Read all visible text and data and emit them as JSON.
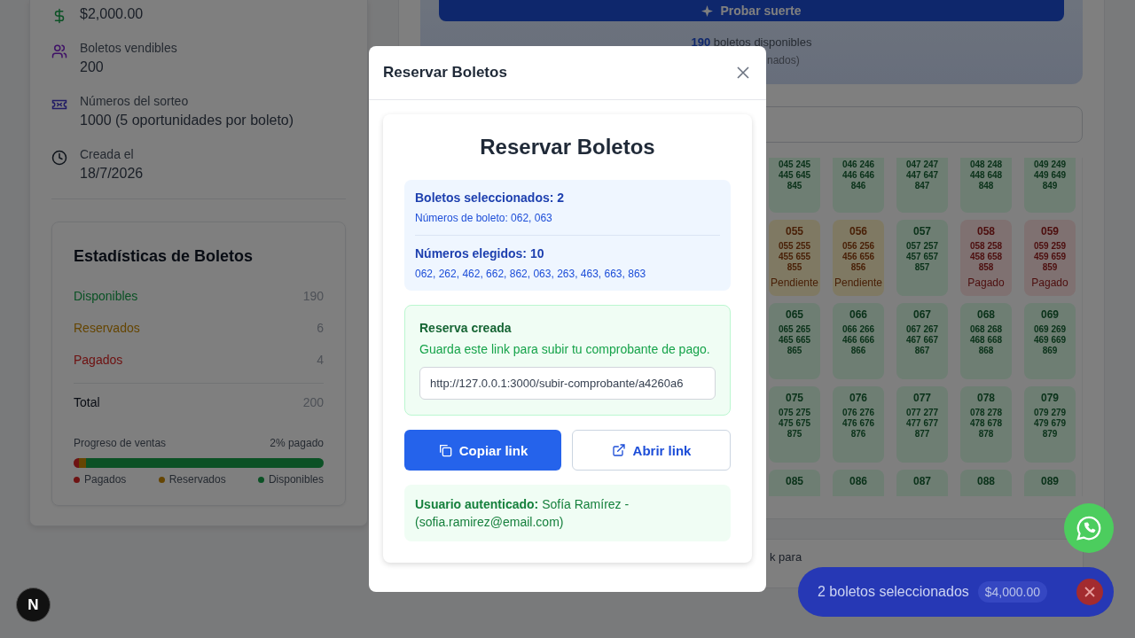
{
  "details": [
    {
      "kind": "price",
      "value": "$2,000.00"
    },
    {
      "kind": "tickets",
      "label": "Boletos vendibles",
      "value": "200"
    },
    {
      "kind": "numbers",
      "label": "Números del sorteo",
      "value": "1000 (5 oportunidades por boleto)"
    },
    {
      "kind": "date",
      "label": "Creada el",
      "value": "18/7/2026"
    }
  ],
  "stats": {
    "title": "Estadísticas de Boletos",
    "rows": [
      {
        "label": "Disponibles",
        "value": "190",
        "kind": "available"
      },
      {
        "label": "Reservados",
        "value": "6",
        "kind": "reserved"
      },
      {
        "label": "Pagados",
        "value": "4",
        "kind": "paid"
      }
    ],
    "total": {
      "label": "Total",
      "value": "200"
    },
    "progress": {
      "label": "Progreso de ventas",
      "reading": "2% pagado",
      "segments": [
        {
          "name": "Pagados",
          "level": 0.02,
          "kind": "paid"
        },
        {
          "name": "Reservados",
          "level": 0.03,
          "kind": "reserved"
        },
        {
          "name": "Disponibles",
          "level": 0.95,
          "kind": "available"
        }
      ]
    }
  },
  "lucky": {
    "button": "Probar suerte",
    "available": "**190** boletos disponibles",
    "selected_note": "nados)"
  },
  "ticket_rows": [
    {
      "tickets": [
        {
          "numbers": [
            "045 245",
            "445 645",
            "845"
          ],
          "kind": "available"
        },
        {
          "numbers": [
            "046 246",
            "446 646",
            "846"
          ],
          "kind": "available"
        },
        {
          "numbers": [
            "047 247",
            "447 647",
            "847"
          ],
          "kind": "available"
        },
        {
          "numbers": [
            "048 248",
            "448 648",
            "848"
          ],
          "kind": "available"
        },
        {
          "numbers": [
            "049 249",
            "449 649",
            "849"
          ],
          "kind": "available"
        }
      ]
    },
    {
      "tickets": [
        {
          "number": "055",
          "numbers": [
            "055 255",
            "455 655",
            "855"
          ],
          "kind": "pending",
          "status_label": "Pendiente"
        },
        {
          "number": "056",
          "numbers": [
            "056 256",
            "456 656",
            "856"
          ],
          "kind": "pending",
          "status_label": "Pendiente"
        },
        {
          "number": "057",
          "numbers": [
            "057 257",
            "457 657",
            "857"
          ],
          "kind": "available"
        },
        {
          "number": "058",
          "numbers": [
            "058 258",
            "458 658",
            "858"
          ],
          "kind": "paid",
          "status_label": "Pagado"
        },
        {
          "number": "059",
          "numbers": [
            "059 259",
            "459 659",
            "859"
          ],
          "kind": "paid",
          "status_label": "Pagado"
        }
      ]
    },
    {
      "tickets": [
        {
          "number": "065",
          "numbers": [
            "065 265",
            "465 665",
            "865"
          ],
          "kind": "available"
        },
        {
          "number": "066",
          "numbers": [
            "066 266",
            "466 666",
            "866"
          ],
          "kind": "available"
        },
        {
          "number": "067",
          "numbers": [
            "067 267",
            "467 667",
            "867"
          ],
          "kind": "available"
        },
        {
          "number": "068",
          "numbers": [
            "068 268",
            "468 668",
            "868"
          ],
          "kind": "available"
        },
        {
          "number": "069",
          "numbers": [
            "069 269",
            "469 669",
            "869"
          ],
          "kind": "available"
        }
      ]
    },
    {
      "tickets": [
        {
          "number": "075",
          "numbers": [
            "075 275",
            "475 675",
            "875"
          ],
          "kind": "available"
        },
        {
          "number": "076",
          "numbers": [
            "076 276",
            "476 676",
            "876"
          ],
          "kind": "available"
        },
        {
          "number": "077",
          "numbers": [
            "077 277",
            "477 677",
            "877"
          ],
          "kind": "available"
        },
        {
          "number": "078",
          "numbers": [
            "078 278",
            "478 678",
            "878"
          ],
          "kind": "available"
        },
        {
          "number": "079",
          "numbers": [
            "079 279",
            "479 679",
            "879"
          ],
          "kind": "available"
        }
      ]
    },
    {
      "tickets": [
        {
          "number": "085",
          "kind": "available"
        },
        {
          "number": "086",
          "kind": "available"
        },
        {
          "number": "087",
          "kind": "available"
        },
        {
          "number": "088",
          "kind": "available"
        },
        {
          "number": "089",
          "kind": "available"
        }
      ]
    }
  ],
  "footer_fragment": "k para",
  "modal": {
    "title": "Reservar Boletos",
    "heading": "Reservar Boletos",
    "selection": {
      "count": "Boletos seleccionados: 2",
      "tickets": "Números de boleto: 062, 063",
      "chosen_title": "Números elegidos: 10",
      "chosen": "062, 262, 462, 662, 862, 063, 263, 463, 663, 863"
    },
    "reservation": {
      "title": "Reserva creada",
      "message": "Guarda este link para subir tu comprobante de pago.",
      "link": "http://127.0.0.1:3000/subir-comprobante/a4260a6"
    },
    "buttons": [
      {
        "kind": "copy",
        "label": "Copiar link"
      },
      {
        "kind": "open",
        "label": "Abrir link"
      }
    ],
    "user": "**Usuario autenticado:** Sofía Ramírez - (sofia.ramirez@email.com)"
  },
  "cart": {
    "text": "2 boletos seleccionados",
    "total": "$4,000.00"
  },
  "dev_badge": "N"
}
